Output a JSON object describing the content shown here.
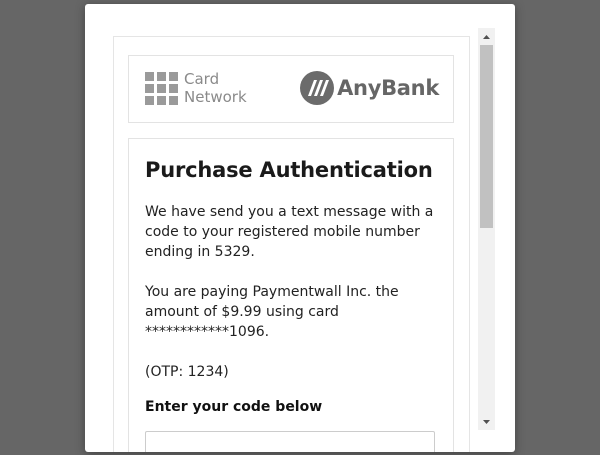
{
  "brand": {
    "card_network_line1": "Card",
    "card_network_line2": "Network",
    "bank_name": "AnyBank"
  },
  "auth": {
    "title": "Purchase Authentication",
    "message": "We have send you a text message with a code to your registered mobile number ending in 5329.",
    "payment_info": "You are paying Paymentwall Inc. the amount of $9.99 using card ************1096.",
    "otp_hint": "(OTP: 1234)",
    "code_label": "Enter your code below",
    "code_value": ""
  },
  "colors": {
    "overlay": "#666666",
    "logo_gray": "#8a8a8a",
    "bank_gray": "#666666"
  }
}
